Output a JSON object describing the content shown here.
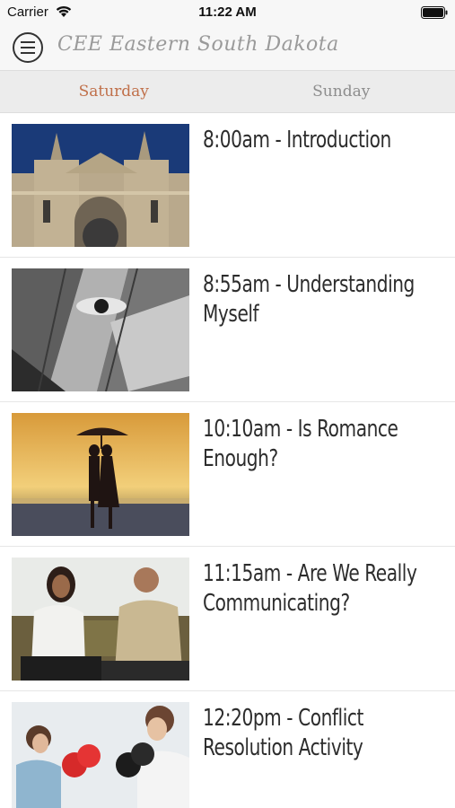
{
  "status_bar": {
    "carrier": "Carrier",
    "time": "11:22 AM",
    "wifi_icon": "wifi-icon",
    "battery_icon": "battery-icon"
  },
  "nav": {
    "menu_icon": "hamburger-menu-icon",
    "title": "CEE Eastern South Dakota"
  },
  "tabs": [
    {
      "label": "Saturday",
      "active": true
    },
    {
      "label": "Sunday",
      "active": false
    }
  ],
  "sessions": [
    {
      "title": "8:00am - Introduction",
      "image": "cathedral-photo"
    },
    {
      "title": "8:55am - Understanding Myself",
      "image": "fragmented-face-photo"
    },
    {
      "title": "10:10am - Is Romance Enough?",
      "image": "couple-umbrella-sunset-photo"
    },
    {
      "title": "11:15am - Are We Really Communicating?",
      "image": "couple-talking-sofa-photo"
    },
    {
      "title": "12:20pm - Conflict Resolution Activity",
      "image": "couple-boxing-gloves-photo"
    }
  ],
  "colors": {
    "active_tab": "#c0704a",
    "inactive_tab": "#8d8d8d",
    "title_gray": "#9a9a9a"
  }
}
